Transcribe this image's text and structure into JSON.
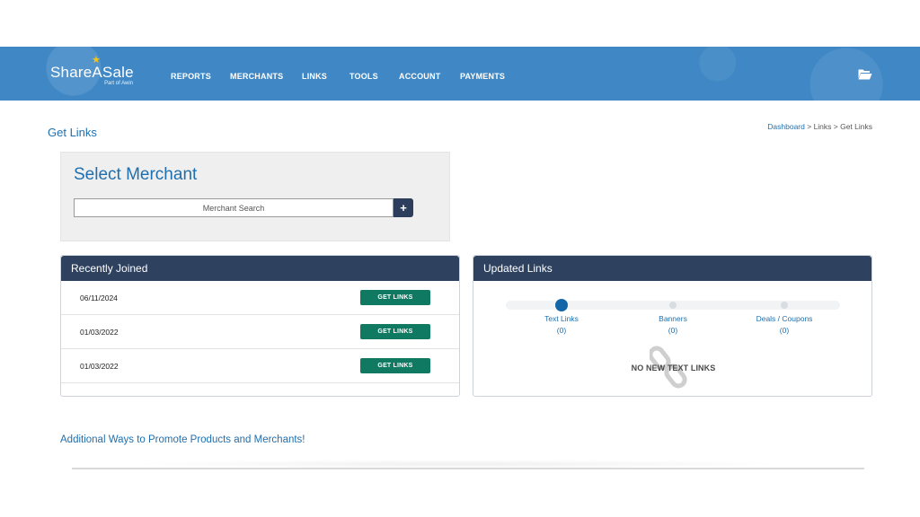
{
  "brand": {
    "name": "ShareASale",
    "tagline": "Part of Awin",
    "star_color": "#f5c518",
    "header_color": "#3f88c5"
  },
  "nav": {
    "items": [
      "REPORTS",
      "MERCHANTS",
      "LINKS",
      "TOOLS",
      "ACCOUNT",
      "PAYMENTS"
    ],
    "folder_icon": "folder-open-icon"
  },
  "page": {
    "title": "Get Links"
  },
  "breadcrumb": {
    "home": "Dashboard",
    "sep1": " > ",
    "mid": "Links",
    "sep2": " > ",
    "current": "Get Links"
  },
  "select_merchant": {
    "title": "Select Merchant",
    "search_placeholder": "Merchant Search",
    "search_button": "+"
  },
  "recently_joined": {
    "title": "Recently Joined",
    "button_label": "GET LINKS",
    "rows": [
      {
        "date": "06/11/2024"
      },
      {
        "date": "01/03/2022"
      },
      {
        "date": "01/03/2022"
      }
    ]
  },
  "updated_links": {
    "title": "Updated Links",
    "steps": [
      {
        "label": "Text Links",
        "count": "(0)"
      },
      {
        "label": "Banners",
        "count": "(0)"
      },
      {
        "label": "Deals / Coupons",
        "count": "(0)"
      }
    ],
    "empty_message": "NO NEW TEXT LINKS",
    "empty_icon": "chain-link-icon"
  },
  "additional": {
    "text": "Additional Ways to Promote Products and Merchants!"
  },
  "colors": {
    "accent": "#1f6fae",
    "panel_header": "#2e4260",
    "button_green": "#0f7a61",
    "active_step": "#1266a8"
  }
}
